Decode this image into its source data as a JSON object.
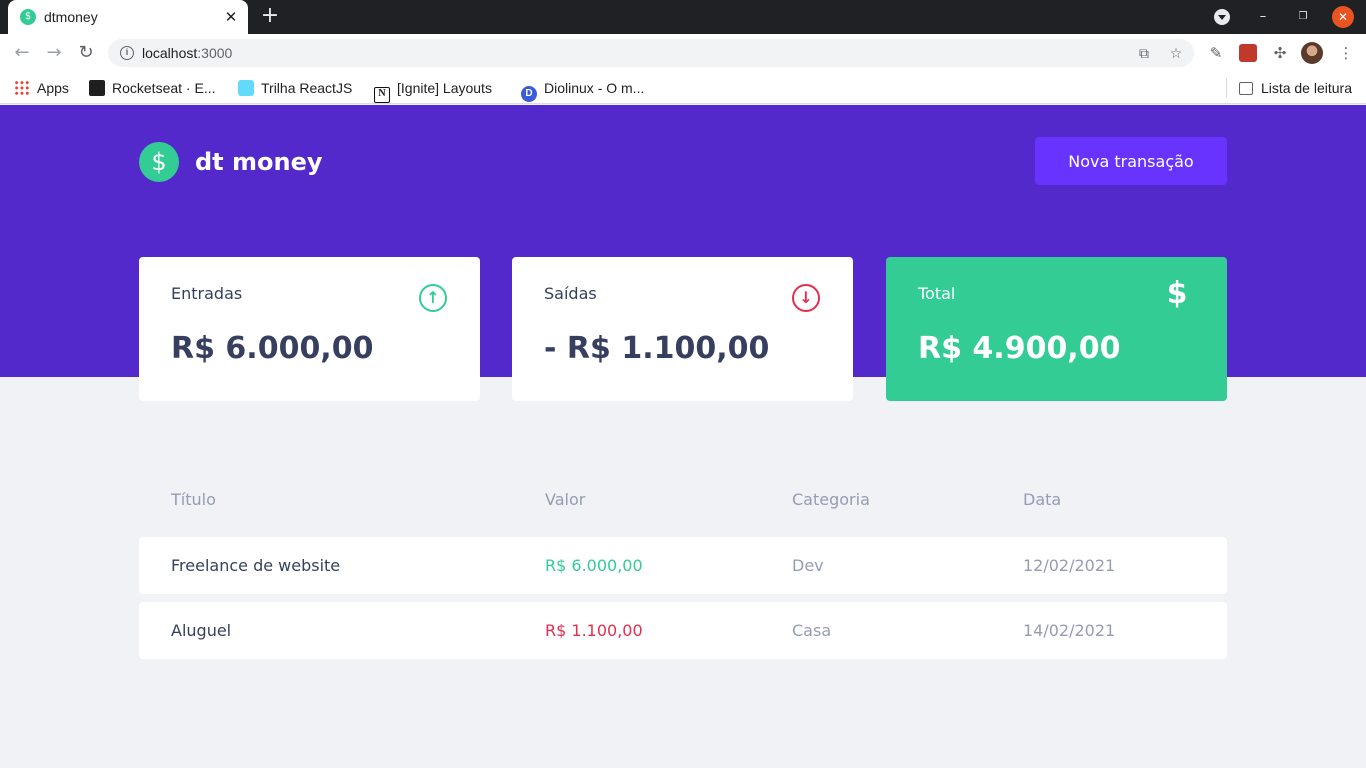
{
  "browser": {
    "tab_title": "dtmoney",
    "url_host": "localhost",
    "url_port": ":3000",
    "bookmarks": [
      "Apps",
      "Rocketseat · E...",
      "Trilha ReactJS",
      "[Ignite] Layouts",
      "Diolinux - O m..."
    ],
    "reading_list": "Lista de leitura"
  },
  "header": {
    "logo_text": "dt money",
    "new_transaction_label": "Nova transação"
  },
  "summary": {
    "income": {
      "label": "Entradas",
      "value": "R$ 6.000,00"
    },
    "outcome": {
      "label": "Saídas",
      "value": "- R$ 1.100,00"
    },
    "total": {
      "label": "Total",
      "value": "R$ 4.900,00"
    }
  },
  "table": {
    "headers": [
      "Título",
      "Valor",
      "Categoria",
      "Data"
    ],
    "rows": [
      {
        "title": "Freelance de website",
        "amount": "R$ 6.000,00",
        "type": "deposit",
        "category": "Dev",
        "date": "12/02/2021"
      },
      {
        "title": "Aluguel",
        "amount": "R$ 1.100,00",
        "type": "withdraw",
        "category": "Casa",
        "date": "14/02/2021"
      }
    ]
  },
  "colors": {
    "header_bg": "#5429cc",
    "button_bg": "#6933ff",
    "green": "#33cc95",
    "red": "#e52e4d",
    "text": "#363f5f",
    "muted": "#969cb3",
    "page_bg": "#f0f2f5"
  }
}
